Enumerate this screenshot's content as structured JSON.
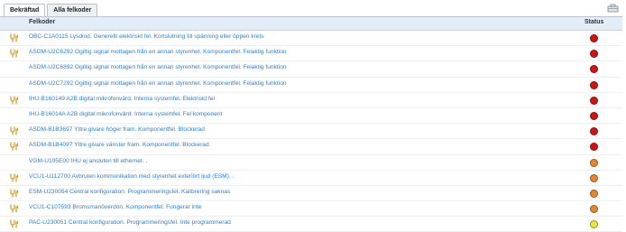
{
  "tabs": [
    "Bekräftad",
    "Alla felkoder"
  ],
  "columns": {
    "code": "Felkoder",
    "status": "Status"
  },
  "status_colors": {
    "red": "#d01414",
    "orange": "#e8872a",
    "yellow": "#e8e83a"
  },
  "rows": [
    {
      "icon": "wrench-icon",
      "text": "OBC-C1A0115 Lysdiod. Generellt elektriskt fel. Kortslutning till spänning eller öppen krets",
      "status": "red"
    },
    {
      "icon": "wrench-icon",
      "text": "ASDM-U2C6292 Ogiltig signal mottagen från en annan styrenhet. Komponentfel. Felaktig funktion",
      "status": "red"
    },
    {
      "icon": "",
      "text": "ASDM-U2C6892 Ogiltig signal mottagen från en annan styrenhet. Komponentfel. Felaktig funktion",
      "status": "red"
    },
    {
      "icon": "",
      "text": "ASDM-U2C7292 Ogiltig signal mottagen från en annan styrenhet. Komponentfel. Felaktig funktion",
      "status": "red"
    },
    {
      "icon": "wrench-icon",
      "text": "IHU-B160149 A2B digital mikrofonvärd. Interna systemfel. Elektriskt fel",
      "status": "red"
    },
    {
      "icon": "",
      "text": "IHU-B16014A A2B digital mikrofonvärd. Interna systemfel. Fel komponent",
      "status": "red"
    },
    {
      "icon": "wrench-icon",
      "text": "ASDM-B1B3697 Yttre givare höger fram. Komponentfel. Blockerad",
      "status": "red"
    },
    {
      "icon": "wrench-icon",
      "text": "ASDM-B1B4097 Yttre givare vänster fram. Komponentfel. Blockerad",
      "status": "red"
    },
    {
      "icon": "",
      "text": "VGM-U105E00 IHU ej ansluten till ethernet. .",
      "status": "orange"
    },
    {
      "icon": "wrench-icon",
      "text": "VCU1-U112700 Avbruten kommunikation med styrenhet exteriört ljud (ESM). .",
      "status": "orange"
    },
    {
      "icon": "wrench-icon",
      "text": "ESM-U230054 Central konfiguration. Programmeringsfel. Kalibrering saknas",
      "status": "orange"
    },
    {
      "icon": "wrench-icon",
      "text": "VCU1-C107593 Bromsmanöverdon. Komponentfel. Fungerar inte",
      "status": "orange"
    },
    {
      "icon": "wrench-icon",
      "text": "PAC-U230051 Central konfiguration. Programmeringsfel. Inte programmerad",
      "status": "yellow"
    }
  ]
}
